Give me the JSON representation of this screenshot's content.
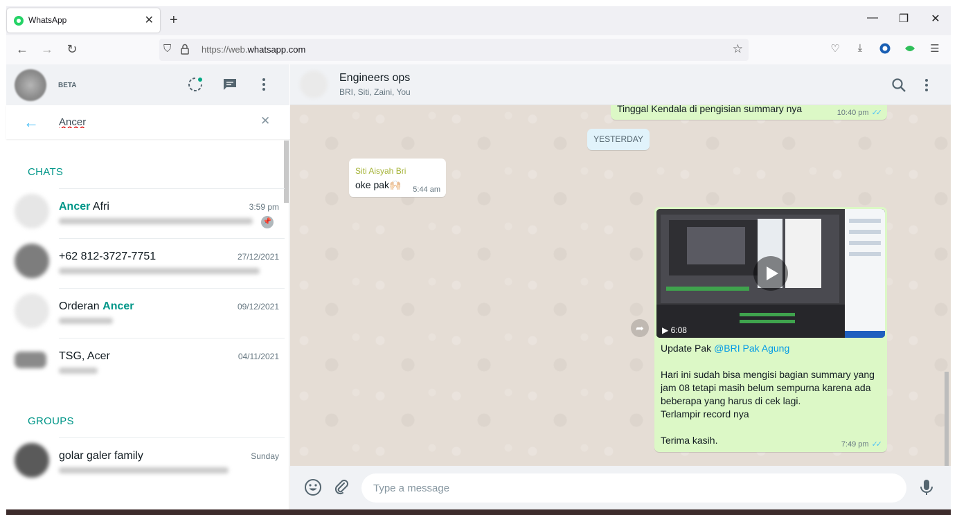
{
  "browser": {
    "tab_title": "WhatsApp",
    "tab_close": "✕",
    "new_tab": "+",
    "url_prefix": "https://web.",
    "url_domain": "whatsapp.com",
    "min": "—",
    "restore": "❐",
    "close": "✕"
  },
  "sidebar": {
    "beta": "BETA",
    "search_value": "Ancer",
    "chats_heading": "CHATS",
    "groups_heading": "GROUPS",
    "chats": [
      {
        "name_hl": "Ancer",
        "name_rest": " Afri",
        "time": "3:59 pm",
        "pinned": true
      },
      {
        "name_hl": "",
        "name_rest": "+62 812-3727-7751",
        "time": "27/12/2021"
      },
      {
        "name_pre": "Orderan ",
        "name_hl": "Ancer",
        "time": "09/12/2021"
      },
      {
        "name_hl": "",
        "name_rest": "TSG, Acer",
        "time": "04/11/2021"
      }
    ],
    "groups": [
      {
        "name": "golar galer family",
        "time": "Sunday"
      }
    ]
  },
  "chat": {
    "title": "Engineers ops",
    "members": "BRI, Siti, Zaini, You",
    "day_chip": "YESTERDAY",
    "prev_message": "Tinggal Kendala  di pengisian summary nya",
    "prev_time": "10:40 pm",
    "incoming_sender": "Siti Aisyah Bri",
    "incoming_text": "oke pak🙌🏻",
    "incoming_time": "5:44 am",
    "video_duration": "6:08",
    "out_prefix": "Update Pak ",
    "out_mention": "@BRI Pak Agung",
    "out_body": "Hari ini sudah bisa mengisi bagian summary yang jam 08 tetapi masih belum sempurna karena ada beberapa yang harus di cek lagi.\nTerlampir record nya\n\nTerima kasih.",
    "out_time": "7:49 pm",
    "composer_placeholder": "Type a message"
  },
  "colors": {
    "accent": "#009688",
    "outgoing_bubble": "#dcf8c6",
    "chat_bg": "#e5ddd5",
    "read_ticks": "#4fc3f7"
  }
}
